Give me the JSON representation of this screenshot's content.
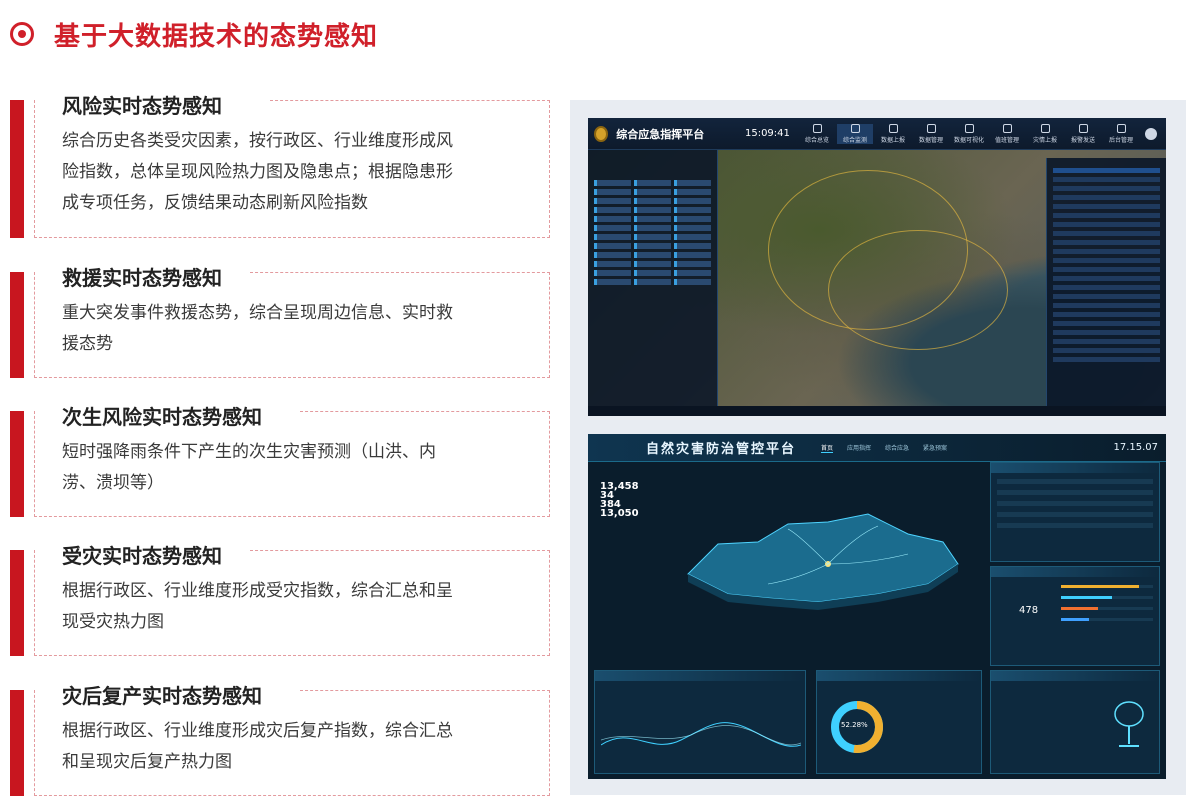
{
  "page_title": "基于大数据技术的态势感知",
  "cards": [
    {
      "title": "风险实时态势感知",
      "lines": [
        "综合历史各类受灾因素，按行政区、行业维度形成风",
        "险指数，总体呈现风险热力图及隐患点；根据隐患形",
        "成专项任务，反馈结果动态刷新风险指数"
      ]
    },
    {
      "title": "救援实时态势感知",
      "lines": [
        "重大突发事件救援态势，综合呈现周边信息、实时救",
        "援态势"
      ]
    },
    {
      "title": "次生风险实时态势感知",
      "lines": [
        "短时强降雨条件下产生的次生灾害预测（山洪、内",
        "涝、溃坝等）"
      ]
    },
    {
      "title": "受灾实时态势感知",
      "lines": [
        "根据行政区、行业维度形成受灾指数，综合汇总和呈",
        "现受灾热力图"
      ]
    },
    {
      "title": "灾后复产实时态势感知",
      "lines": [
        "根据行政区、行业维度形成灾后复产指数，综合汇总",
        "和呈现灾后复产热力图"
      ]
    }
  ],
  "screenshot1": {
    "title": "综合应急指挥平台",
    "time": "15:09:41",
    "nav": [
      "综合总览",
      "综合监测",
      "数据上报",
      "数据管理",
      "数据可视化",
      "值班管理",
      "灾情上报",
      "报警发送",
      "后台管理"
    ],
    "active_nav": 1
  },
  "screenshot2": {
    "title": "自然灾害防治管控平台",
    "time": "17.15.07",
    "nav": [
      "首页",
      "应用指挥",
      "综合应急",
      "紧急预案"
    ],
    "stats": [
      {
        "value": "13,458"
      },
      {
        "value": "34"
      },
      {
        "value": "384"
      },
      {
        "value": "13,050"
      }
    ],
    "donut_value": "478",
    "pie_value": "52.28%"
  }
}
